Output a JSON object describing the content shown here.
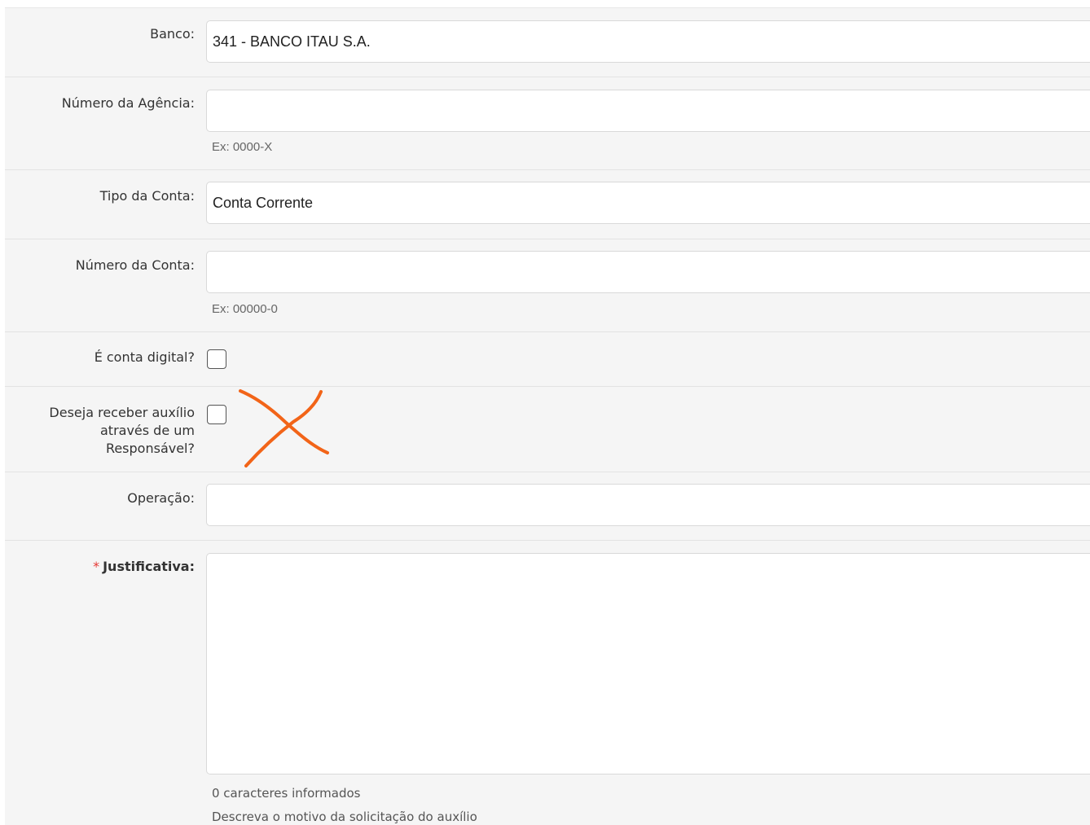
{
  "fields": {
    "banco": {
      "label": "Banco:",
      "value": "341 - BANCO ITAU S.A."
    },
    "agencia": {
      "label": "Número da Agência:",
      "value": "",
      "help": "Ex: 0000-X"
    },
    "tipo_conta": {
      "label": "Tipo da Conta:",
      "value": "Conta Corrente"
    },
    "numero_conta": {
      "label": "Número da Conta:",
      "value": "",
      "help": "Ex: 00000-0"
    },
    "conta_digital": {
      "label": "É conta digital?",
      "checked": false
    },
    "responsavel": {
      "label": "Deseja receber auxílio através de um Responsável?",
      "checked": false
    },
    "operacao": {
      "label": "Operação:",
      "value": ""
    },
    "justificativa": {
      "required_mark": "*",
      "label": "Justificativa:",
      "value": "",
      "counter": "0 caracteres informados",
      "help": "Descreva o motivo da solicitação do auxílio"
    }
  },
  "annotation_color": "#f26418"
}
